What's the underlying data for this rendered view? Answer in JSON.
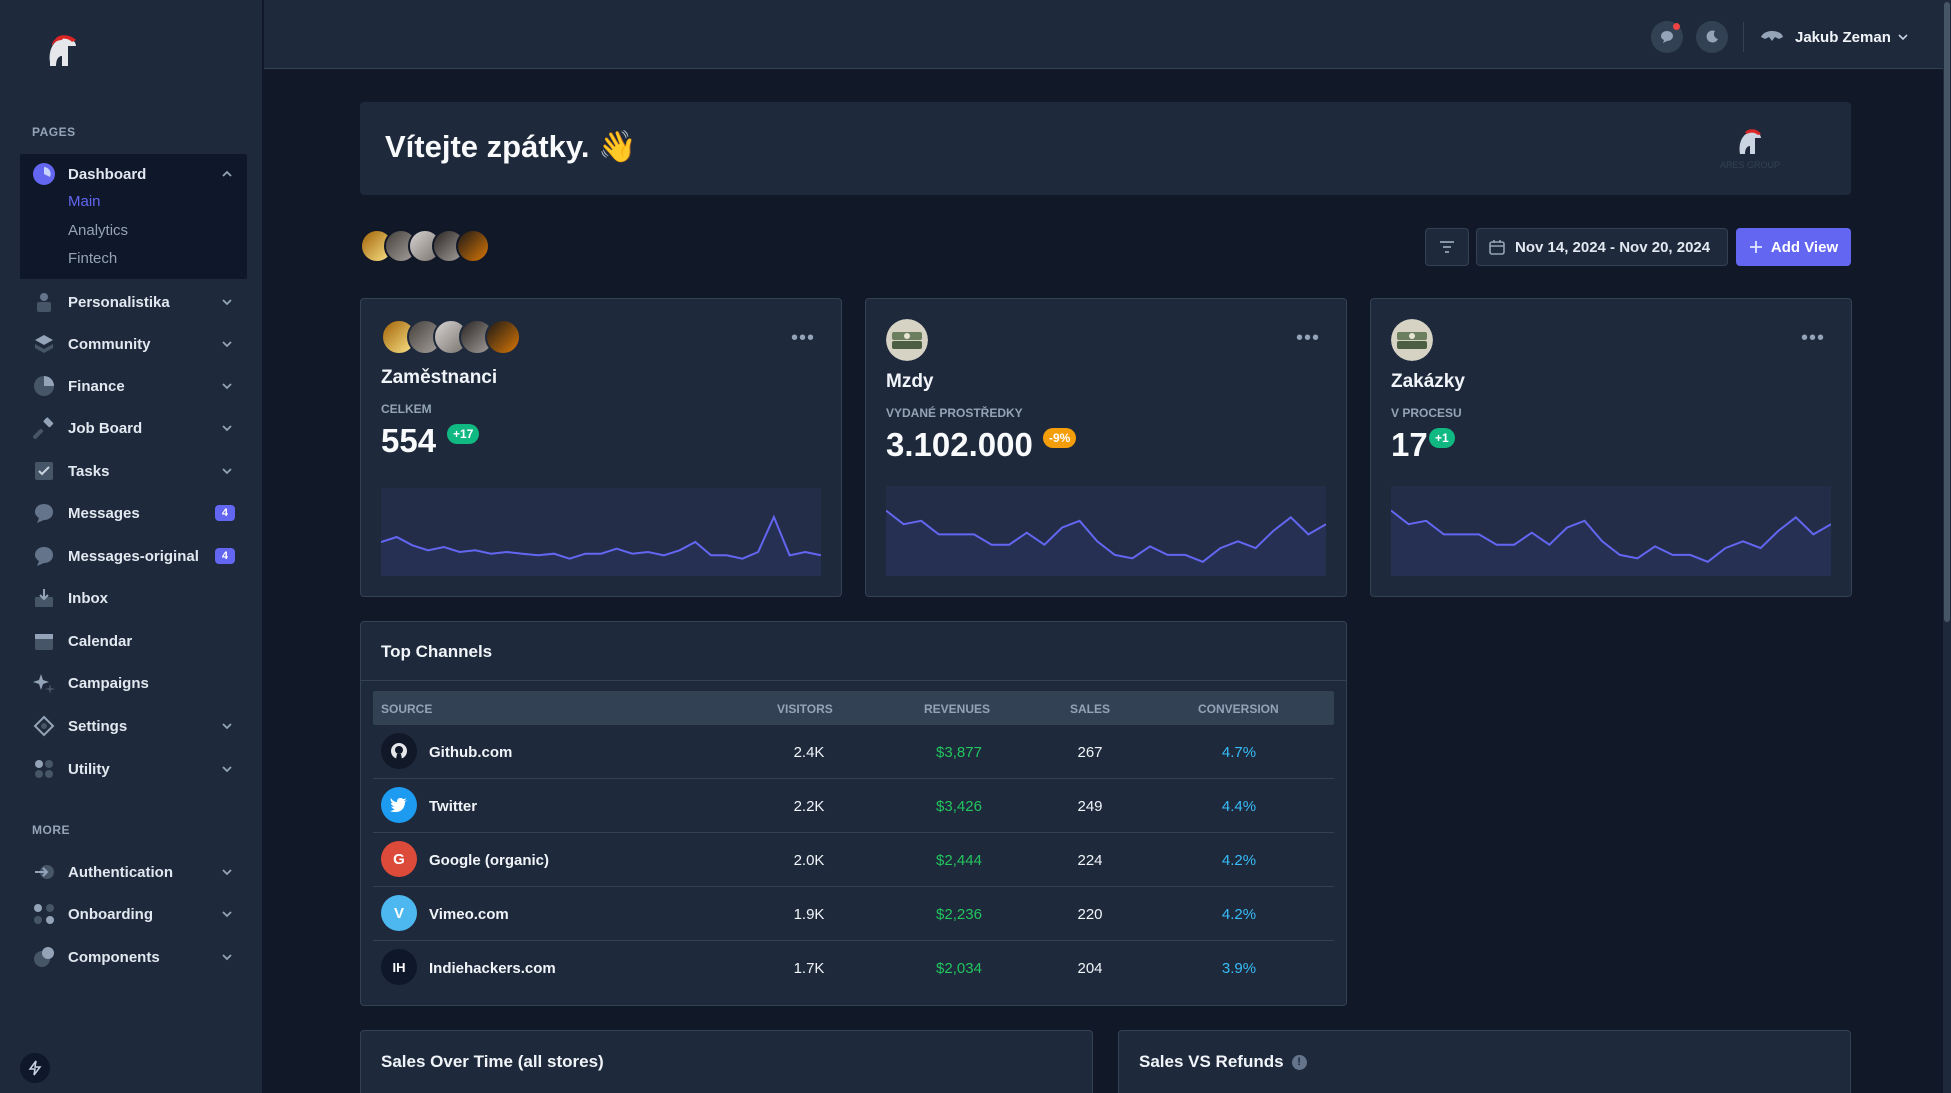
{
  "sidebar": {
    "pages_label": "PAGES",
    "more_label": "MORE",
    "dashboard": {
      "label": "Dashboard",
      "sub": [
        "Main",
        "Analytics",
        "Fintech"
      ]
    },
    "items": [
      {
        "label": "Personalistika"
      },
      {
        "label": "Community"
      },
      {
        "label": "Finance"
      },
      {
        "label": "Job Board"
      },
      {
        "label": "Tasks"
      },
      {
        "label": "Messages",
        "badge": "4"
      },
      {
        "label": "Messages-original",
        "badge": "4"
      },
      {
        "label": "Inbox"
      },
      {
        "label": "Calendar"
      },
      {
        "label": "Campaigns"
      },
      {
        "label": "Settings"
      },
      {
        "label": "Utility"
      }
    ],
    "more_items": [
      {
        "label": "Authentication"
      },
      {
        "label": "Onboarding"
      },
      {
        "label": "Components"
      }
    ]
  },
  "header": {
    "user_name": "Jakub Zeman"
  },
  "welcome": {
    "title": "Vítejte zpátky. 👋",
    "brand_text": "ARES GROUP"
  },
  "toolbar": {
    "date_range": "Nov 14, 2024 - Nov 20, 2024",
    "add_view": "Add View"
  },
  "cards": [
    {
      "title": "Zaměstnanci",
      "label": "Celkem",
      "value": "554",
      "delta": "+17",
      "spark": [
        30,
        27,
        32,
        35,
        33,
        36,
        35,
        37,
        36,
        37,
        38,
        37,
        40,
        37,
        37,
        34,
        37,
        36,
        38,
        35,
        30,
        38,
        38,
        40,
        36,
        15,
        38,
        36,
        38
      ]
    },
    {
      "title": "Mzdy",
      "label": "Vydané prostředky",
      "value": "3.102.000",
      "delta": "-9%",
      "spark": [
        12,
        20,
        18,
        26,
        26,
        26,
        32,
        32,
        25,
        32,
        22,
        18,
        30,
        38,
        40,
        33,
        38,
        38,
        42,
        34,
        30,
        34,
        24,
        16,
        26,
        20
      ]
    },
    {
      "title": "Zakázky",
      "label": "V procesu",
      "value": "17",
      "delta": "+1",
      "spark": [
        12,
        20,
        18,
        26,
        26,
        26,
        32,
        32,
        25,
        32,
        22,
        18,
        30,
        38,
        40,
        33,
        38,
        38,
        42,
        34,
        30,
        34,
        24,
        16,
        26,
        20
      ]
    }
  ],
  "channels": {
    "title": "Top Channels",
    "headers": [
      "SOURCE",
      "VISITORS",
      "REVENUES",
      "SALES",
      "CONVERSION"
    ],
    "rows": [
      {
        "icon": "github-icon",
        "initials": "",
        "name": "Github.com",
        "visitors": "2.4K",
        "revenue": "$3,877",
        "sales": "267",
        "conversion": "4.7%"
      },
      {
        "icon": "twitter-icon",
        "initials": "",
        "name": "Twitter",
        "visitors": "2.2K",
        "revenue": "$3,426",
        "sales": "249",
        "conversion": "4.4%"
      },
      {
        "icon": "google-icon",
        "initials": "G",
        "name": "Google (organic)",
        "visitors": "2.0K",
        "revenue": "$2,444",
        "sales": "224",
        "conversion": "4.2%"
      },
      {
        "icon": "vimeo-icon",
        "initials": "V",
        "name": "Vimeo.com",
        "visitors": "1.9K",
        "revenue": "$2,236",
        "sales": "220",
        "conversion": "4.2%"
      },
      {
        "icon": "indiehackers-icon",
        "initials": "IH",
        "name": "Indiehackers.com",
        "visitors": "1.7K",
        "revenue": "$2,034",
        "sales": "204",
        "conversion": "3.9%"
      }
    ]
  },
  "bottom": {
    "sales_over_time": "Sales Over Time (all stores)",
    "sales_vs_refunds": "Sales VS Refunds",
    "info_glyph": "!"
  },
  "colors": {
    "accent": "#6366f1",
    "positive": "#22c55e",
    "warning": "#f59e0b",
    "link": "#38bdf8"
  }
}
